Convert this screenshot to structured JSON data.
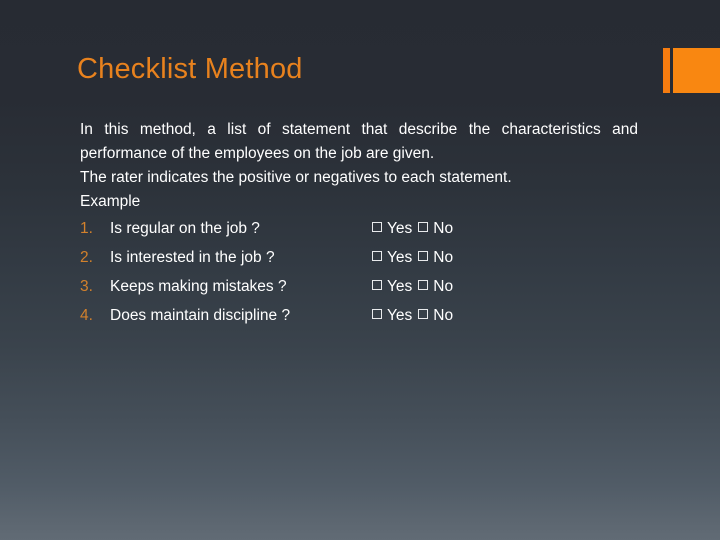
{
  "slide": {
    "title": "Checklist Method",
    "paragraphs": [
      "In this method, a list of statement that describe the characteristics and performance of the employees on the job are given.",
      "The rater indicates the positive or negatives to each statement.",
      "Example"
    ],
    "checklist": [
      {
        "number": "1.",
        "statement": "Is regular on the job  ?",
        "options": [
          {
            "box": "checkbox-empty",
            "label": "Yes"
          },
          {
            "box": "checkbox-empty",
            "label": "No"
          }
        ]
      },
      {
        "number": "2.",
        "statement": "Is interested in the job ?",
        "options": [
          {
            "box": "checkbox-empty",
            "label": "Yes"
          },
          {
            "box": "checkbox-empty",
            "label": "No"
          }
        ]
      },
      {
        "number": "3.",
        "statement": "Keeps making mistakes ?",
        "options": [
          {
            "box": "checkbox-empty",
            "label": "Yes"
          },
          {
            "box": "checkbox-empty",
            "label": "No"
          }
        ]
      },
      {
        "number": "4.",
        "statement": "Does maintain discipline ?",
        "options": [
          {
            "box": "checkbox-empty",
            "label": "Yes"
          },
          {
            "box": "checkbox-empty",
            "label": "No"
          }
        ]
      }
    ],
    "colors": {
      "title": "#E8821E",
      "accent_bar": "#F98711",
      "accent_bar_thin": "#F57C10",
      "list_number": "#D2812C",
      "body_text": "#FFFFFF",
      "background_top": "#272b33",
      "background_bottom": "#616b75"
    },
    "decoration": {
      "thin_bar": "accent-bar-thin",
      "block_bar": "accent-bar-block"
    }
  }
}
